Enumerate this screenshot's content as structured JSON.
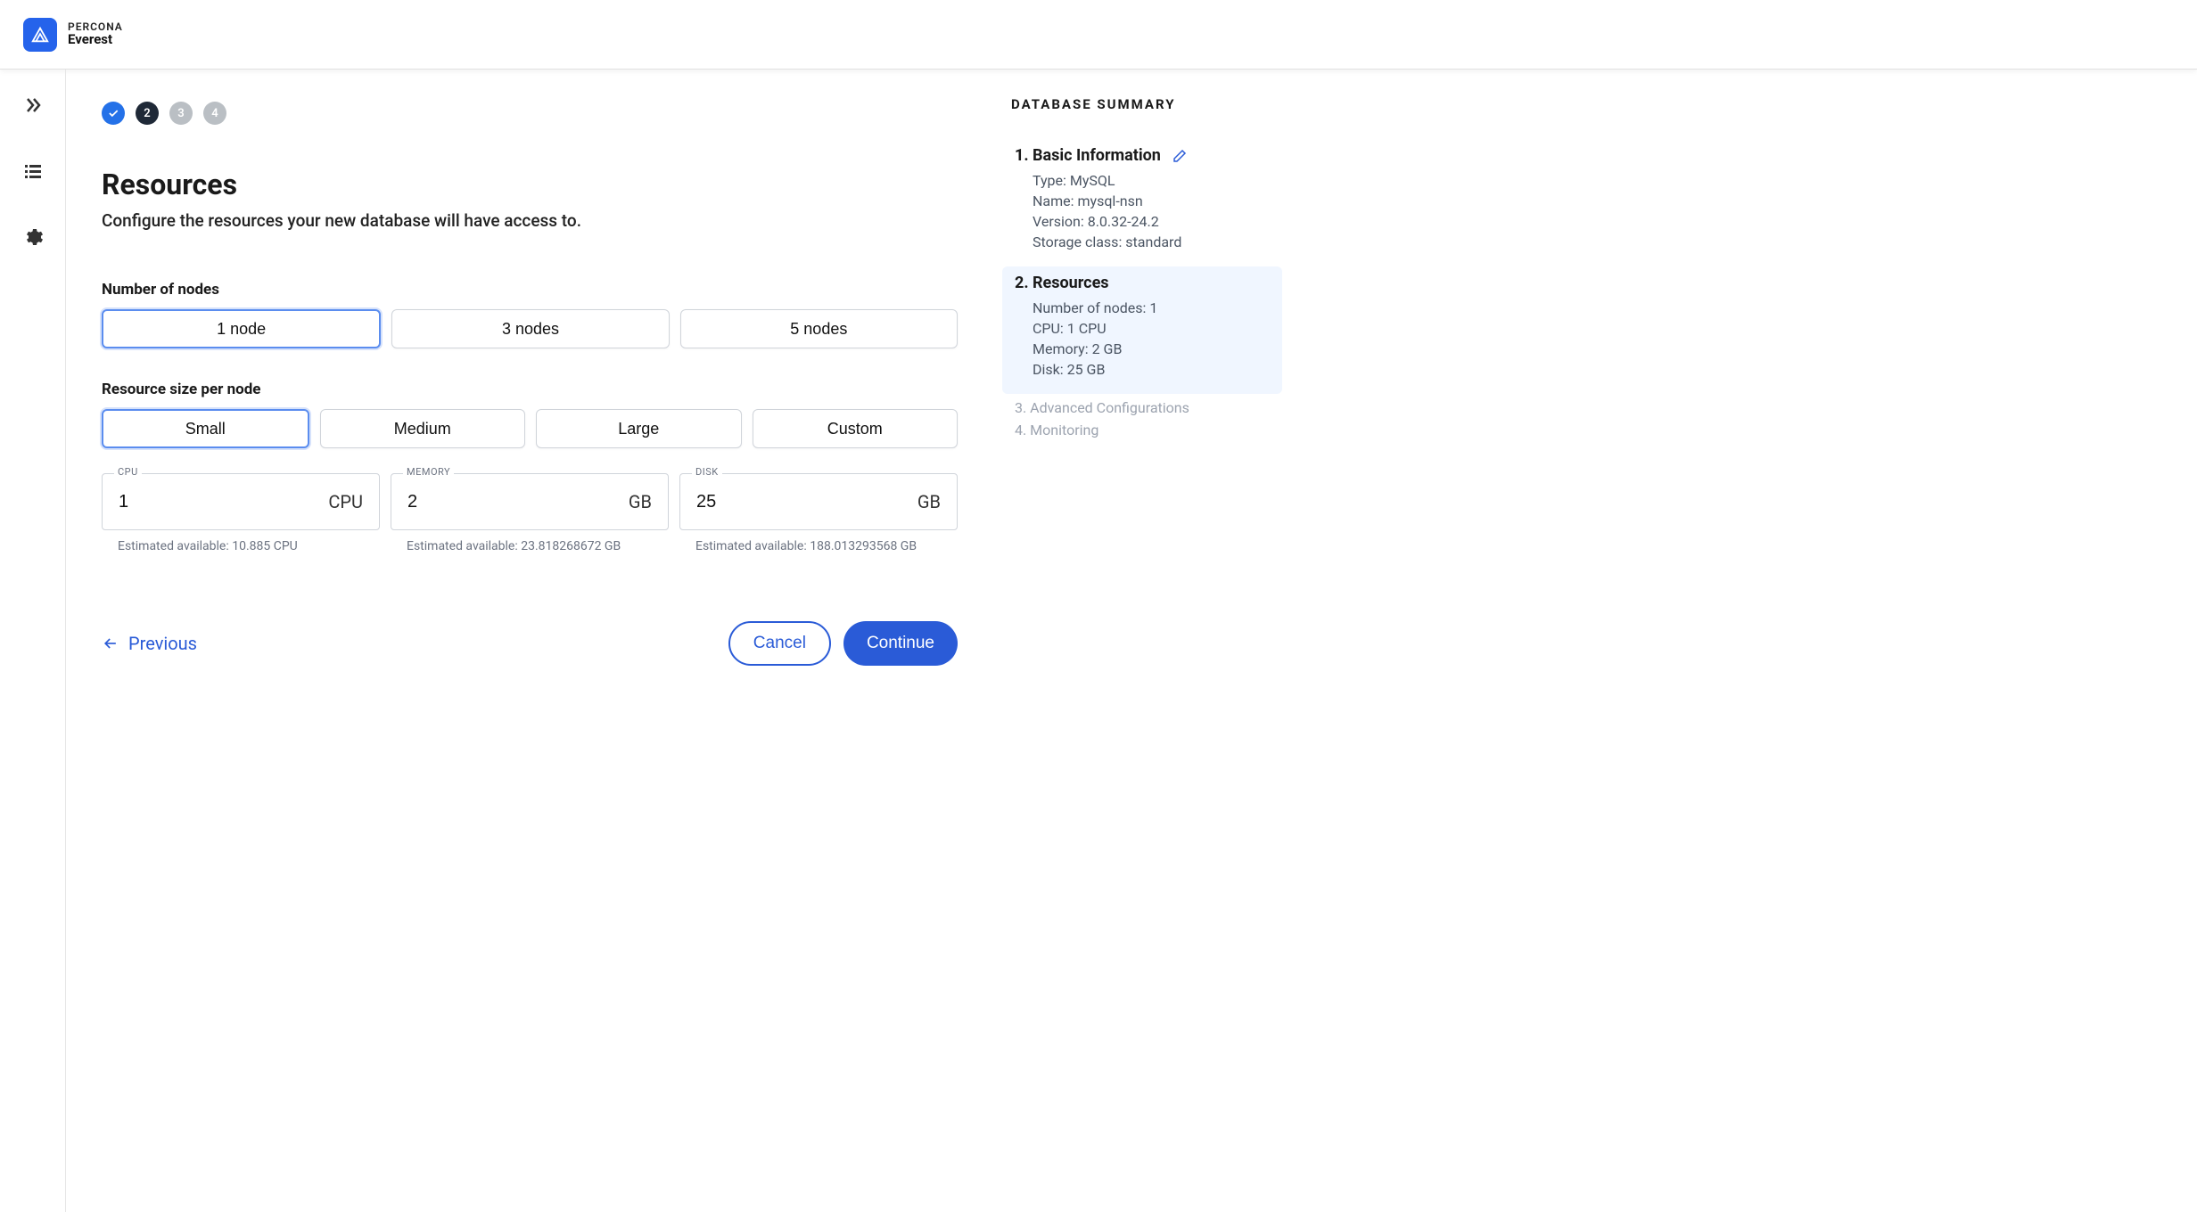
{
  "brand": {
    "line1": "PERCONA",
    "line2": "Everest"
  },
  "stepper": {
    "done_icon": "✓",
    "active": "2",
    "s3": "3",
    "s4": "4"
  },
  "page": {
    "title": "Resources",
    "subtitle": "Configure the resources your new database will have access to."
  },
  "nodes": {
    "label": "Number of nodes",
    "options": [
      "1 node",
      "3 nodes",
      "5 nodes"
    ]
  },
  "sizes": {
    "label": "Resource size per node",
    "options": [
      "Small",
      "Medium",
      "Large",
      "Custom"
    ]
  },
  "fields": {
    "cpu": {
      "label": "CPU",
      "value": "1",
      "unit": "CPU",
      "help": "Estimated available: 10.885 CPU"
    },
    "mem": {
      "label": "MEMORY",
      "value": "2",
      "unit": "GB",
      "help": "Estimated available: 23.818268672 GB"
    },
    "disk": {
      "label": "DISK",
      "value": "25",
      "unit": "GB",
      "help": "Estimated available: 188.013293568 GB"
    }
  },
  "nav": {
    "previous": "Previous",
    "cancel": "Cancel",
    "continue": "Continue"
  },
  "summary": {
    "title": "DATABASE SUMMARY",
    "s1": {
      "head": "1. Basic Information",
      "lines": [
        "Type: MySQL",
        "Name: mysql-nsn",
        "Version: 8.0.32-24.2",
        "Storage class: standard"
      ]
    },
    "s2": {
      "head": "2. Resources",
      "lines": [
        "Number of nodes: 1",
        "CPU: 1 CPU",
        "Memory: 2 GB",
        "Disk: 25 GB"
      ]
    },
    "s3": "3. Advanced Configurations",
    "s4": "4. Monitoring"
  }
}
